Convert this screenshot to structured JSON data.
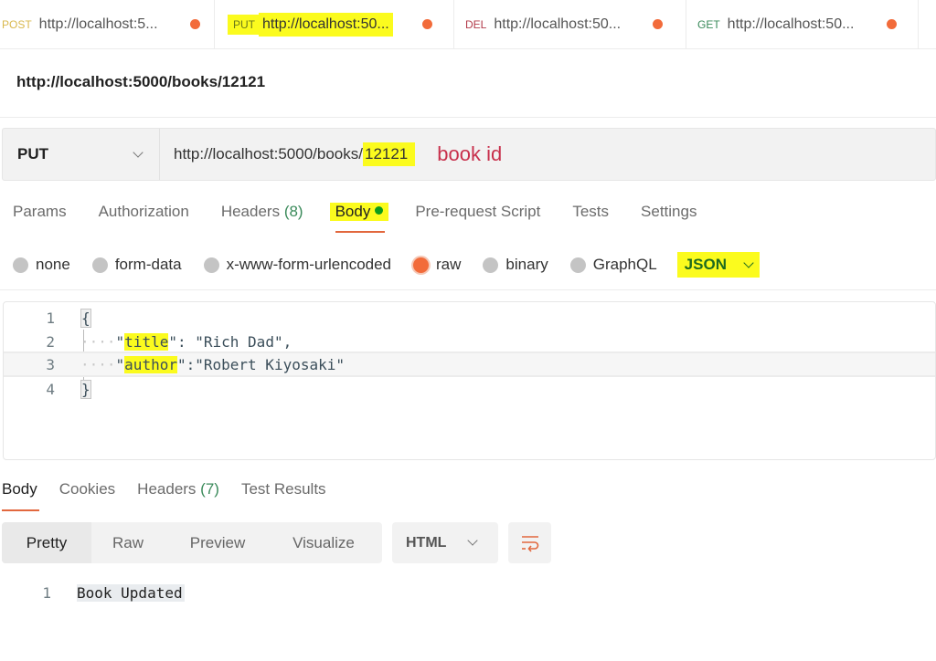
{
  "request_tabs": [
    {
      "method": "POST",
      "url": "http://localhost:5...",
      "unsaved": true
    },
    {
      "method": "PUT",
      "url": "http://localhost:50...",
      "unsaved": true,
      "active": true
    },
    {
      "method": "DEL",
      "url": "http://localhost:50...",
      "unsaved": true
    },
    {
      "method": "GET",
      "url": "http://localhost:50...",
      "unsaved": true
    }
  ],
  "request_name": "http://localhost:5000/books/12121",
  "url_bar": {
    "method": "PUT",
    "url_base": "http://localhost:5000/books/",
    "url_id": "12121",
    "annotation": "book id"
  },
  "request_sections": {
    "params": "Params",
    "authorization": "Authorization",
    "headers": "Headers",
    "headers_count": "(8)",
    "body": "Body",
    "pre_request": "Pre-request Script",
    "tests": "Tests",
    "settings": "Settings"
  },
  "body_types": {
    "none": "none",
    "form_data": "form-data",
    "urlencoded": "x-www-form-urlencoded",
    "raw": "raw",
    "binary": "binary",
    "graphql": "GraphQL",
    "selected": "raw",
    "format": "JSON"
  },
  "editor": {
    "lines": [
      {
        "n": "1",
        "text": "{"
      },
      {
        "n": "2",
        "indent": "····",
        "q1": "\"",
        "key": "title",
        "q2": "\"",
        "rest": ": \"Rich Dad\","
      },
      {
        "n": "3",
        "indent": "····",
        "q1": "\"",
        "key": "author",
        "q2": "\"",
        "rest": ":\"Robert Kiyosaki\""
      },
      {
        "n": "4",
        "text": "}"
      }
    ]
  },
  "response": {
    "tabs": {
      "body": "Body",
      "cookies": "Cookies",
      "headers": "Headers",
      "headers_count": "(7)",
      "test_results": "Test Results"
    },
    "views": {
      "pretty": "Pretty",
      "raw": "Raw",
      "preview": "Preview",
      "visualize": "Visualize"
    },
    "language": "HTML",
    "lines": [
      {
        "n": "1",
        "text": "Book Updated"
      }
    ]
  },
  "colors": {
    "accent": "#f26b3a",
    "highlight": "#fbfb1e",
    "green_dot": "#0c9c1c",
    "annotation": "#c8304c"
  }
}
